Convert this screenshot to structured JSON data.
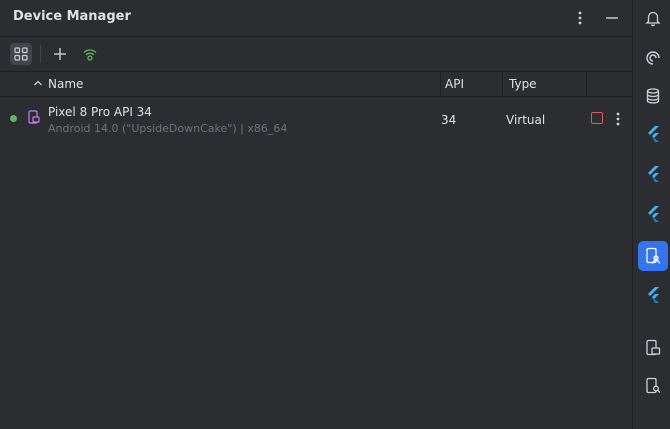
{
  "panel": {
    "title": "Device Manager"
  },
  "table": {
    "columns": {
      "name": "Name",
      "api": "API",
      "type": "Type"
    },
    "rows": [
      {
        "name": "Pixel 8 Pro API 34",
        "subtitle": "Android 14.0 (\"UpsideDownCake\") | x86_64",
        "api": "34",
        "type": "Virtual",
        "status": "running"
      }
    ]
  },
  "colors": {
    "background": "#2b2d30",
    "divider": "#1e1f22",
    "text": "#dfe1e5",
    "muted": "#6f737a",
    "status_running": "#5fb85f",
    "stop": "#db5c5c",
    "accent": "#3574f0",
    "flutter": "#42b4f5"
  },
  "icons": {
    "title_actions": [
      "more-vertical-icon",
      "minimize-icon"
    ],
    "toolbar": [
      "grid-view-icon",
      "add-icon",
      "wifi-pair-icon"
    ],
    "rail": [
      "notifications-icon",
      "swirl-icon",
      "database-icon",
      "flutter-icon",
      "flutter-icon",
      "flutter-icon",
      "device-manager-icon",
      "flutter-icon",
      "running-devices-icon",
      "device-explorer-icon"
    ]
  }
}
